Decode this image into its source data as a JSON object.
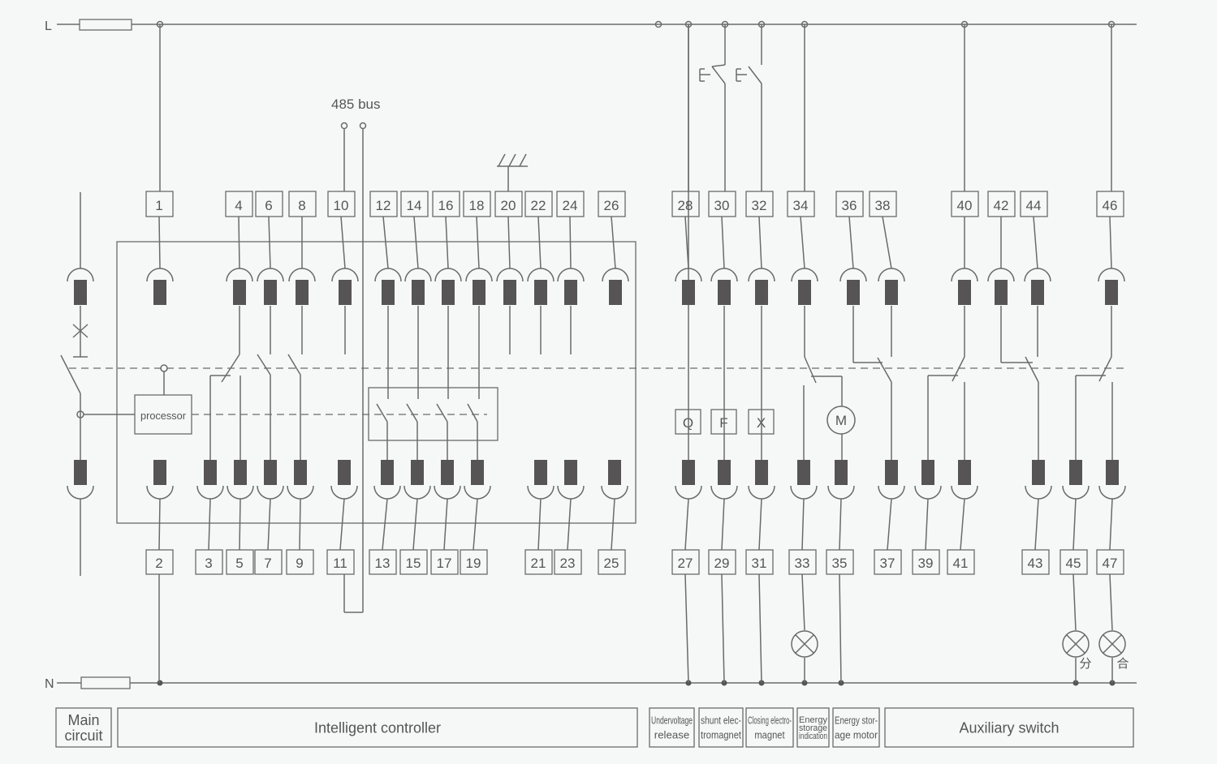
{
  "lines": {
    "live": "L",
    "neutral": "N"
  },
  "bus_label": "485 bus",
  "processor_label": "processor",
  "top_terminals": [
    "1",
    "4",
    "6",
    "8",
    "10",
    "12",
    "14",
    "16",
    "18",
    "20",
    "22",
    "24",
    "26",
    "28",
    "30",
    "32",
    "34",
    "36",
    "38",
    "40",
    "42",
    "44",
    "46"
  ],
  "bottom_terminals": [
    "2",
    "3",
    "5",
    "7",
    "9",
    "11",
    "13",
    "15",
    "17",
    "19",
    "21",
    "23",
    "25",
    "27",
    "29",
    "31",
    "33",
    "35",
    "37",
    "39",
    "41",
    "43",
    "45",
    "47"
  ],
  "coil_labels": [
    "Q",
    "F",
    "X"
  ],
  "motor_label": "M",
  "lamp_labels": [
    "分",
    "合"
  ],
  "sections": [
    {
      "lines": [
        "Main",
        "circuit"
      ]
    },
    {
      "lines": [
        "Intelligent controller"
      ]
    },
    {
      "lines": [
        "Undervoltage",
        "release"
      ]
    },
    {
      "lines": [
        "shunt elec-",
        "tromagnet"
      ]
    },
    {
      "lines": [
        "Closing electro-",
        "magnet"
      ]
    },
    {
      "lines": [
        "Energy",
        "storage",
        "indication"
      ]
    },
    {
      "lines": [
        "Energy stor-",
        "age  motor"
      ]
    },
    {
      "lines": [
        "Auxiliary switch"
      ]
    }
  ],
  "colors": {
    "line": "#6a6a6a",
    "contact": "#565455",
    "background": "#f6f8f8"
  }
}
